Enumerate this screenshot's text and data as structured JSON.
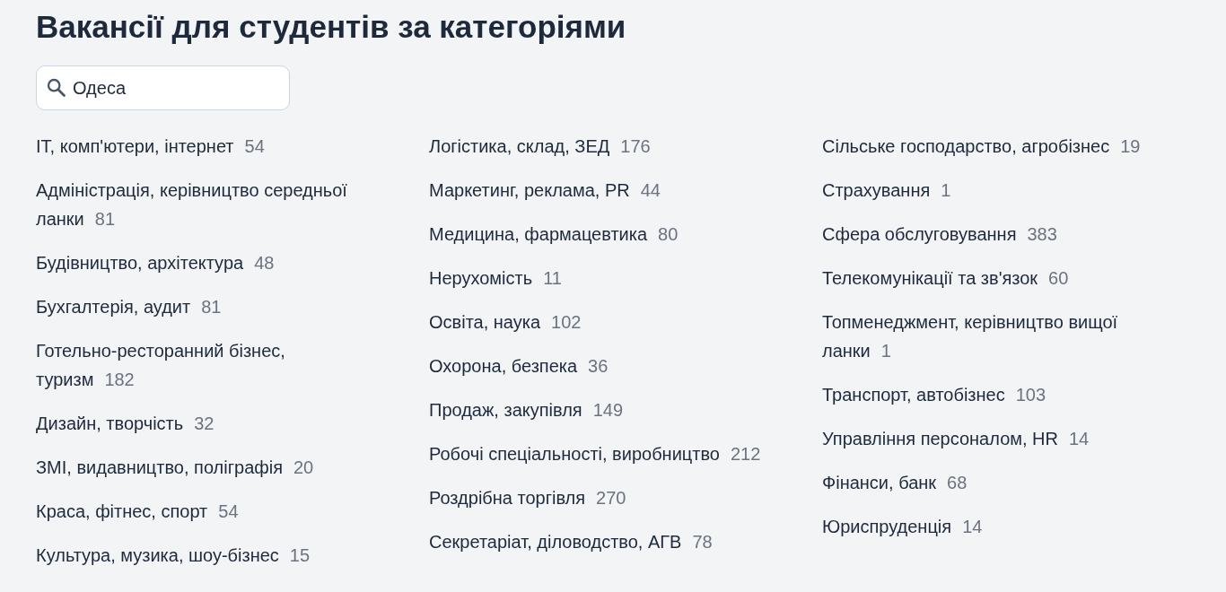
{
  "title": "Вакансії для студентів за категоріями",
  "search": {
    "value": "Одеса"
  },
  "columns": [
    {
      "categories": [
        {
          "label": "IT, комп'ютери, інтернет",
          "count": "54"
        },
        {
          "label": "Адміністрація, керівництво середньої ланки",
          "count": "81"
        },
        {
          "label": "Будівництво, архітектура",
          "count": "48"
        },
        {
          "label": "Бухгалтерія, аудит",
          "count": "81"
        },
        {
          "label": "Готельно-ресторанний бізнес, туризм",
          "count": "182"
        },
        {
          "label": "Дизайн, творчість",
          "count": "32"
        },
        {
          "label": "ЗМІ, видавництво, поліграфія",
          "count": "20"
        },
        {
          "label": "Краса, фітнес, спорт",
          "count": "54"
        },
        {
          "label": "Культура, музика, шоу-бізнес",
          "count": "15"
        }
      ]
    },
    {
      "categories": [
        {
          "label": "Логістика, склад, ЗЕД",
          "count": "176"
        },
        {
          "label": "Маркетинг, реклама, PR",
          "count": "44"
        },
        {
          "label": "Медицина, фармацевтика",
          "count": "80"
        },
        {
          "label": "Нерухомість",
          "count": "11"
        },
        {
          "label": "Освіта, наука",
          "count": "102"
        },
        {
          "label": "Охорона, безпека",
          "count": "36"
        },
        {
          "label": "Продаж, закупівля",
          "count": "149"
        },
        {
          "label": "Робочі спеціальності, виробництво",
          "count": "212"
        },
        {
          "label": "Роздрібна торгівля",
          "count": "270"
        },
        {
          "label": "Секретаріат, діловодство, АГВ",
          "count": "78"
        }
      ]
    },
    {
      "categories": [
        {
          "label": "Сільське господарство, агробізнес",
          "count": "19"
        },
        {
          "label": "Страхування",
          "count": "1"
        },
        {
          "label": "Сфера обслуговування",
          "count": "383"
        },
        {
          "label": "Телекомунікації та зв'язок",
          "count": "60"
        },
        {
          "label": "Топменеджмент, керівництво вищої ланки",
          "count": "1"
        },
        {
          "label": "Транспорт, автобізнес",
          "count": "103"
        },
        {
          "label": "Управління персоналом, HR",
          "count": "14"
        },
        {
          "label": "Фінанси, банк",
          "count": "68"
        },
        {
          "label": "Юриспруденція",
          "count": "14"
        }
      ]
    }
  ]
}
